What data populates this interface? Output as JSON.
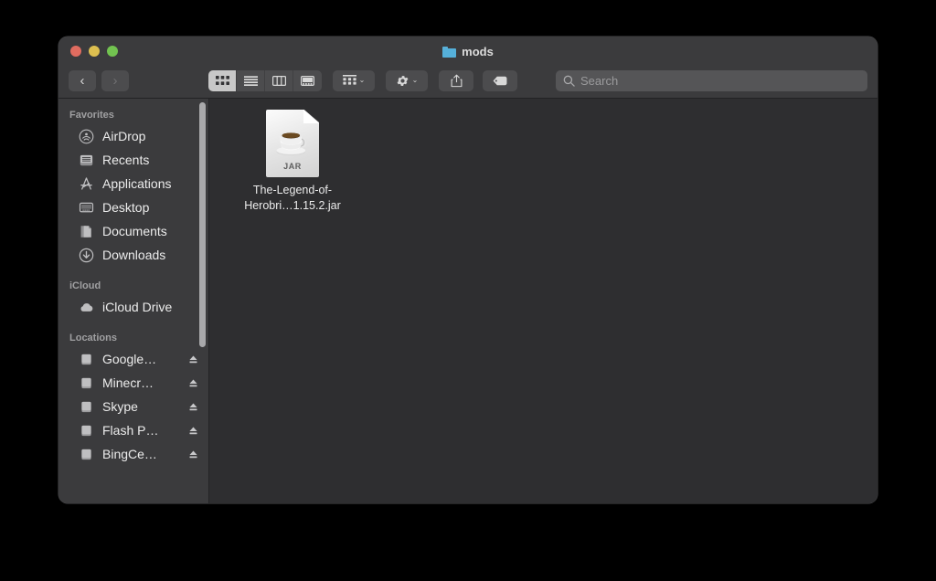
{
  "window": {
    "title": "mods",
    "folder_icon": "folder-icon",
    "traffic_lights": [
      {
        "name": "close-button",
        "color": "#e06c60"
      },
      {
        "name": "minimize-button",
        "color": "#ddbf50"
      },
      {
        "name": "maximize-button",
        "color": "#72c350"
      }
    ]
  },
  "toolbar": {
    "back_label": "‹",
    "forward_label": "›",
    "view_modes": [
      {
        "name": "icon-view",
        "icon": "grid-icon",
        "active": true
      },
      {
        "name": "list-view",
        "icon": "list-icon",
        "active": false
      },
      {
        "name": "column-view",
        "icon": "columns-icon",
        "active": false
      },
      {
        "name": "gallery-view",
        "icon": "gallery-icon",
        "active": false
      }
    ],
    "group_button": {
      "name": "group-by-button",
      "icon": "grid-small-icon"
    },
    "action_button": {
      "name": "action-menu-button",
      "icon": "gear-icon"
    },
    "share_button": {
      "name": "share-button",
      "icon": "share-icon"
    },
    "tags_button": {
      "name": "tags-button",
      "icon": "tag-icon"
    },
    "caret": "⌄"
  },
  "search": {
    "placeholder": "Search",
    "value": "",
    "icon": "search-icon"
  },
  "sidebar": {
    "sections": [
      {
        "title": "Favorites",
        "items": [
          {
            "label": "AirDrop",
            "icon": "airdrop-icon",
            "eject": false
          },
          {
            "label": "Recents",
            "icon": "recents-icon",
            "eject": false
          },
          {
            "label": "Applications",
            "icon": "applications-icon",
            "eject": false
          },
          {
            "label": "Desktop",
            "icon": "desktop-icon",
            "eject": false
          },
          {
            "label": "Documents",
            "icon": "documents-icon",
            "eject": false
          },
          {
            "label": "Downloads",
            "icon": "downloads-icon",
            "eject": false
          }
        ]
      },
      {
        "title": "iCloud",
        "items": [
          {
            "label": "iCloud Drive",
            "icon": "cloud-icon",
            "eject": false
          }
        ]
      },
      {
        "title": "Locations",
        "items": [
          {
            "label": "Google…",
            "icon": "drive-icon",
            "eject": true
          },
          {
            "label": "Minecr…",
            "icon": "drive-icon",
            "eject": true
          },
          {
            "label": "Skype",
            "icon": "drive-icon",
            "eject": true
          },
          {
            "label": "Flash P…",
            "icon": "drive-icon",
            "eject": true
          },
          {
            "label": "BingCe…",
            "icon": "drive-icon",
            "eject": true
          }
        ]
      }
    ]
  },
  "content": {
    "files": [
      {
        "name": "The-Legend-of-Herobri…1.15.2.jar",
        "icon": "jar-file-icon",
        "badge": "JAR"
      }
    ]
  }
}
